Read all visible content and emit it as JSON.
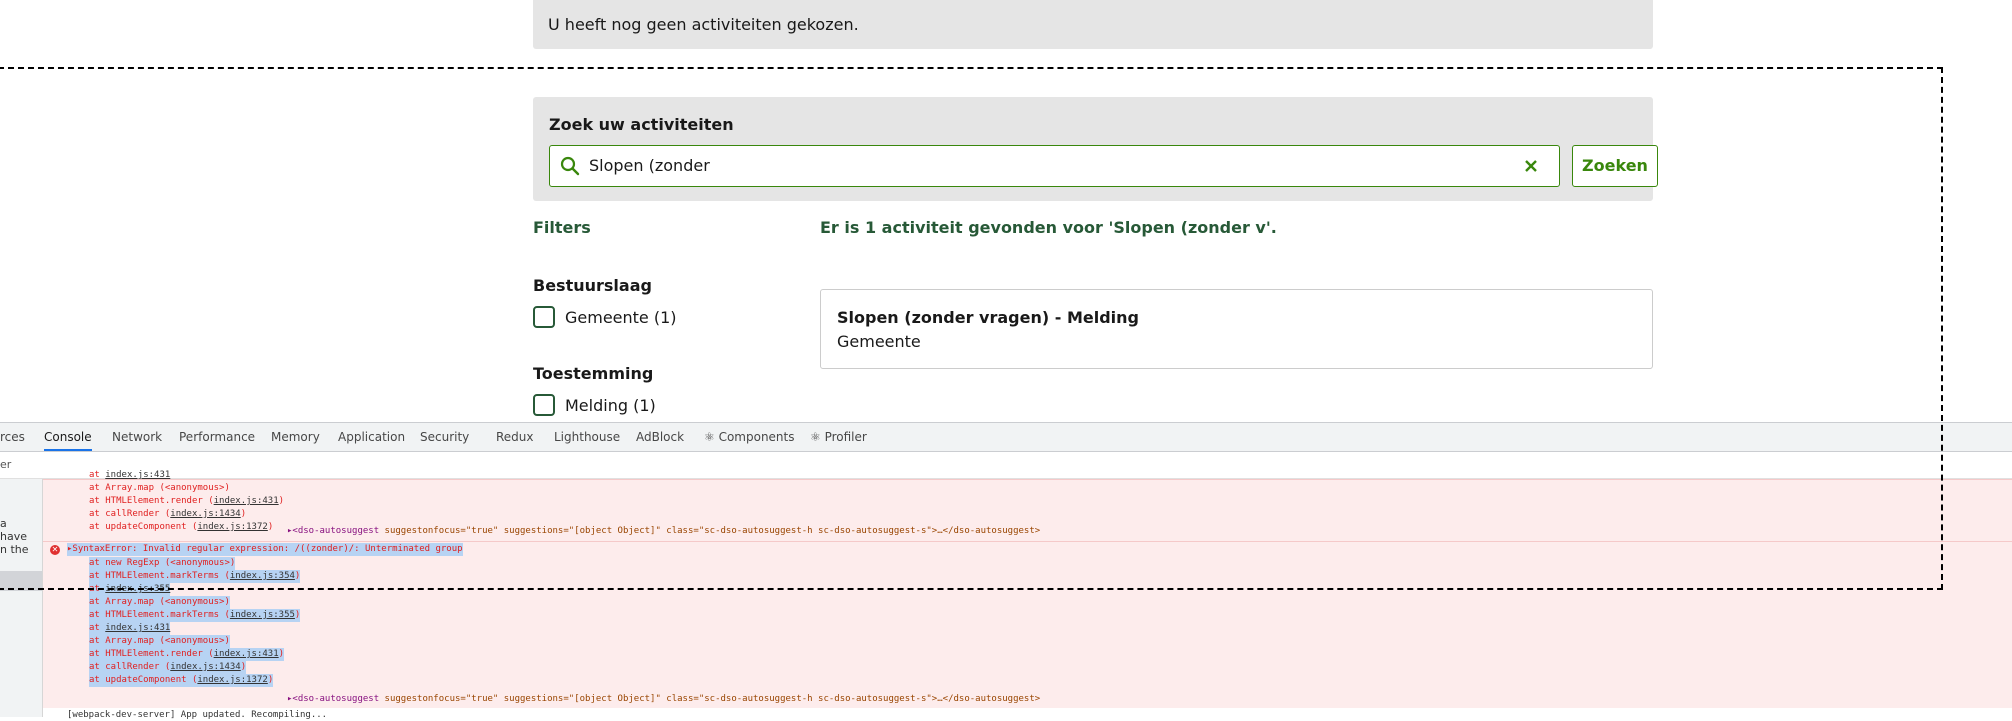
{
  "notice": "U heeft nog geen activiteiten gekozen.",
  "search": {
    "title": "Zoek uw activiteiten",
    "value": "Slopen (zonder",
    "button": "Zoeken"
  },
  "filters": {
    "title": "Filters",
    "groups": [
      {
        "title": "Bestuurslaag",
        "option": "Gemeente (1)"
      },
      {
        "title": "Toestemming",
        "option": "Melding (1)"
      }
    ]
  },
  "results": {
    "count_text": "Er is 1 activiteit gevonden voor 'Slopen (zonder v'.",
    "items": [
      {
        "title": "Slopen (zonder vragen) - Melding",
        "subtitle": "Gemeente"
      }
    ]
  },
  "devtools": {
    "tabs": [
      "rces",
      "Console",
      "Network",
      "Performance",
      "Memory",
      "Application",
      "Security",
      "Redux",
      "Lighthouse",
      "AdBlock",
      "⚛ Components",
      "⚛ Profiler"
    ],
    "active_tab": "Console",
    "filter_placeholder": "er",
    "sidebar_text": [
      "a",
      "have",
      "n the"
    ],
    "block1": [
      {
        "pre": "at ",
        "link": "index.js:431",
        "post": ""
      },
      {
        "pre": "at Array.map (<anonymous>)",
        "link": "",
        "post": ""
      },
      {
        "pre": "at HTMLElement.render (",
        "link": "index.js:431",
        "post": ")"
      },
      {
        "pre": "at callRender (",
        "link": "index.js:1434",
        "post": ")"
      },
      {
        "pre": "at updateComponent (",
        "link": "index.js:1372",
        "post": ")"
      }
    ],
    "element_tag": "▸<dso-autosuggest",
    "element_attrs": " suggestonfocus=\"true\" suggestions=\"[object Object]\" class=\"sc-dso-autosuggest-h sc-dso-autosuggest-s\">…</dso-autosuggest>",
    "error_message": "▸SyntaxError: Invalid regular expression: /((zonder)/: Unterminated group",
    "block2": [
      {
        "pre": "at new RegExp (<anonymous>)",
        "link": "",
        "post": ""
      },
      {
        "pre": "at HTMLElement.markTerms (",
        "link": "index.js:354",
        "post": ")"
      },
      {
        "pre": "at ",
        "link": "index.js:355",
        "post": ""
      },
      {
        "pre": "at Array.map (<anonymous>)",
        "link": "",
        "post": ""
      },
      {
        "pre": "at HTMLElement.markTerms (",
        "link": "index.js:355",
        "post": ")"
      },
      {
        "pre": "at ",
        "link": "index.js:431",
        "post": ""
      },
      {
        "pre": "at Array.map (<anonymous>)",
        "link": "",
        "post": ""
      },
      {
        "pre": "at HTMLElement.render (",
        "link": "index.js:431",
        "post": ")"
      },
      {
        "pre": "at callRender (",
        "link": "index.js:1434",
        "post": ")"
      },
      {
        "pre": "at updateComponent (",
        "link": "index.js:1372",
        "post": ")"
      }
    ],
    "log_message": "[webpack-dev-server] App updated. Recompiling..."
  },
  "colors": {
    "accent_green": "#39870c",
    "dark_green": "#275937",
    "error_bg": "#fdecec",
    "error_text": "#e02020"
  }
}
